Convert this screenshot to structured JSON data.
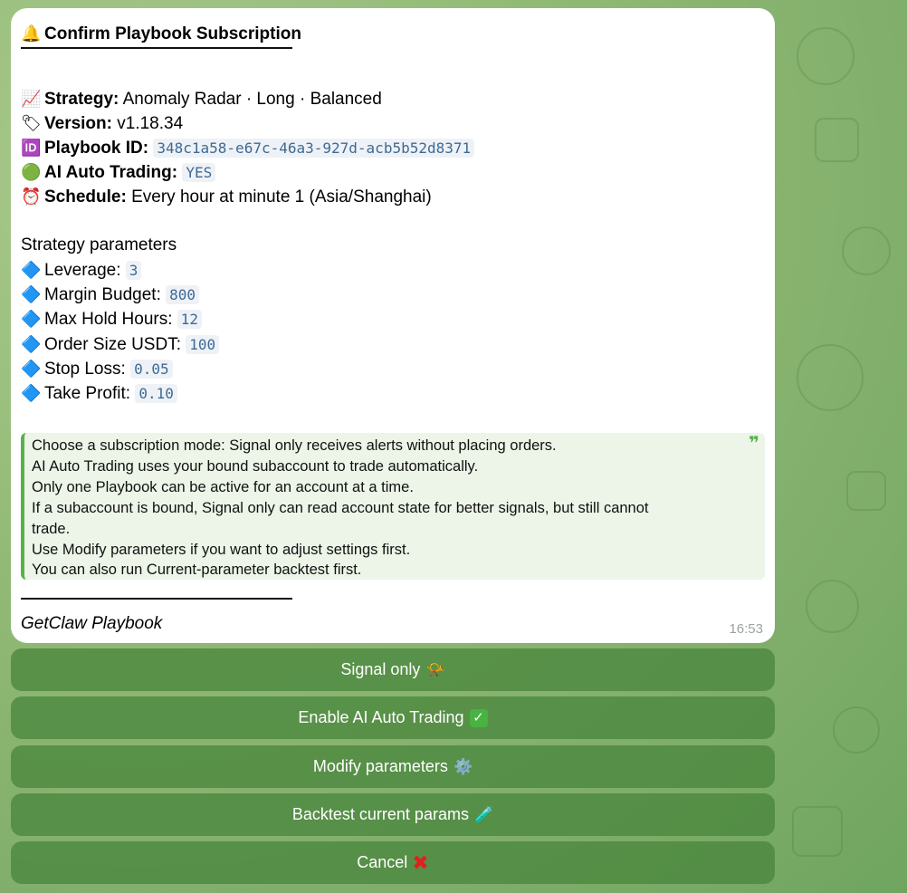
{
  "message": {
    "title_icon": "🔔",
    "title": "Confirm Playbook Subscription",
    "details": [
      {
        "icon": "📈",
        "icon_name": "chart-increasing-icon",
        "label": "Strategy:",
        "value": "Anomaly Radar · Long · Balanced",
        "code": false
      },
      {
        "icon": "🏷",
        "icon_name": "tag-icon",
        "label": "Version:",
        "value": "v1.18.34",
        "code": false
      },
      {
        "icon": "🆔",
        "icon_name": "id-icon",
        "label": "Playbook ID:",
        "value": "348c1a58-e67c-46a3-927d-acb5b52d8371",
        "code": true
      },
      {
        "icon": "🟢",
        "icon_name": "green-circle-icon",
        "label": "AI Auto Trading:",
        "value": "YES",
        "code": true
      },
      {
        "icon": "⏰",
        "icon_name": "alarm-clock-icon",
        "label": "Schedule:",
        "value": "Every hour at minute 1 (Asia/Shanghai)",
        "code": false
      }
    ],
    "params_heading": "Strategy parameters",
    "param_icon": "🔷",
    "params": [
      {
        "label": "Leverage:",
        "value": "3"
      },
      {
        "label": "Margin Budget:",
        "value": "800"
      },
      {
        "label": "Max Hold Hours:",
        "value": "12"
      },
      {
        "label": "Order Size USDT:",
        "value": "100"
      },
      {
        "label": "Stop Loss:",
        "value": "0.05"
      },
      {
        "label": "Take Profit:",
        "value": "0.10"
      }
    ],
    "quote_mark": "❞",
    "quote_lines": [
      "Choose a subscription mode: Signal only receives alerts without placing orders.",
      "AI Auto Trading uses your bound subaccount to trade automatically.",
      "Only one Playbook can be active for an account at a time.",
      "If a subaccount is bound, Signal only can read account state for better signals, but still cannot",
      "trade.",
      "Use Modify parameters if you want to adjust settings first.",
      "You can also run Current-parameter backtest first."
    ],
    "footer": "GetClaw Playbook",
    "time": "16:53"
  },
  "buttons": [
    {
      "name": "signal-only-button",
      "label": "Signal only",
      "emoji": "📯",
      "emoji_name": "postal-horn-icon"
    },
    {
      "name": "enable-ai-auto-trading-button",
      "label": "Enable AI Auto Trading",
      "emoji": "✓",
      "emoji_name": "check-mark-button-icon"
    },
    {
      "name": "modify-parameters-button",
      "label": "Modify parameters",
      "emoji": "⚙️",
      "emoji_name": "gear-icon"
    },
    {
      "name": "backtest-current-params-button",
      "label": "Backtest current params",
      "emoji": "🧪",
      "emoji_name": "test-tube-icon"
    },
    {
      "name": "cancel-button",
      "label": "Cancel",
      "emoji": "✖",
      "emoji_name": "cross-mark-icon"
    }
  ]
}
